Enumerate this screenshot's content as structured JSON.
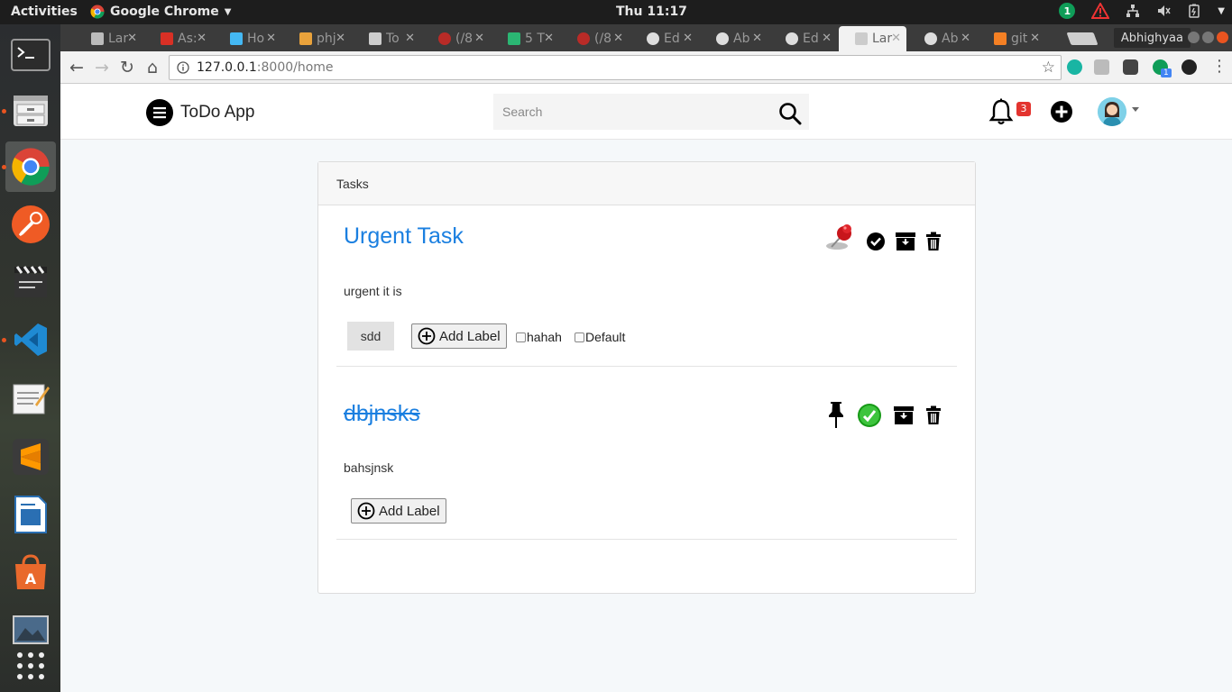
{
  "system": {
    "activities": "Activities",
    "app_name": "Google Chrome",
    "clock": "Thu 11:17",
    "update_badge": "1"
  },
  "dock": {
    "apps": [
      "terminal-icon",
      "files-icon",
      "chrome-icon",
      "postman-icon",
      "video-editor-icon",
      "vscode-icon",
      "text-editor-icon",
      "sublime-icon",
      "writer-icon",
      "software-center-icon",
      "image-viewer-icon",
      "app-grid-icon"
    ]
  },
  "browser": {
    "tabs": [
      {
        "label": "Lar",
        "icon": "laravel-icon"
      },
      {
        "label": "As:",
        "icon": "gmail-icon"
      },
      {
        "label": "Ho",
        "icon": "flutter-icon"
      },
      {
        "label": "phj",
        "icon": "phpmyadmin-icon"
      },
      {
        "label": "To",
        "icon": "page-icon"
      },
      {
        "label": "(/8",
        "icon": "quora-icon"
      },
      {
        "label": "5 T",
        "icon": "link-icon"
      },
      {
        "label": "(/8",
        "icon": "quora-icon"
      },
      {
        "label": "Ed",
        "icon": "github-icon"
      },
      {
        "label": "Ab",
        "icon": "github-icon"
      },
      {
        "label": "Ed",
        "icon": "github-icon"
      },
      {
        "label": "Lar",
        "icon": "page-icon"
      },
      {
        "label": "Ab",
        "icon": "github-icon"
      },
      {
        "label": "git",
        "icon": "stackoverflow-icon"
      }
    ],
    "active_tab_index": 11,
    "profile": "Abhighyaa",
    "url_host": "127.0.0.1",
    "url_path": ":8000/home",
    "extension_badge": "1"
  },
  "app": {
    "brand": "ToDo App",
    "search_placeholder": "Search",
    "notification_count": "3"
  },
  "card": {
    "header": "Tasks",
    "tasks": [
      {
        "title": "Urgent Task",
        "description": "urgent it is",
        "completed": false,
        "pinned": true,
        "labels": [
          "sdd"
        ],
        "add_label": "Add Label",
        "options": [
          {
            "label": "hahah",
            "checked": false
          },
          {
            "label": "Default",
            "checked": false
          }
        ]
      },
      {
        "title": "dbjnsks",
        "description": "bahsjnsk",
        "completed": true,
        "pinned": false,
        "labels": [],
        "add_label": "Add Label",
        "options": []
      }
    ]
  }
}
